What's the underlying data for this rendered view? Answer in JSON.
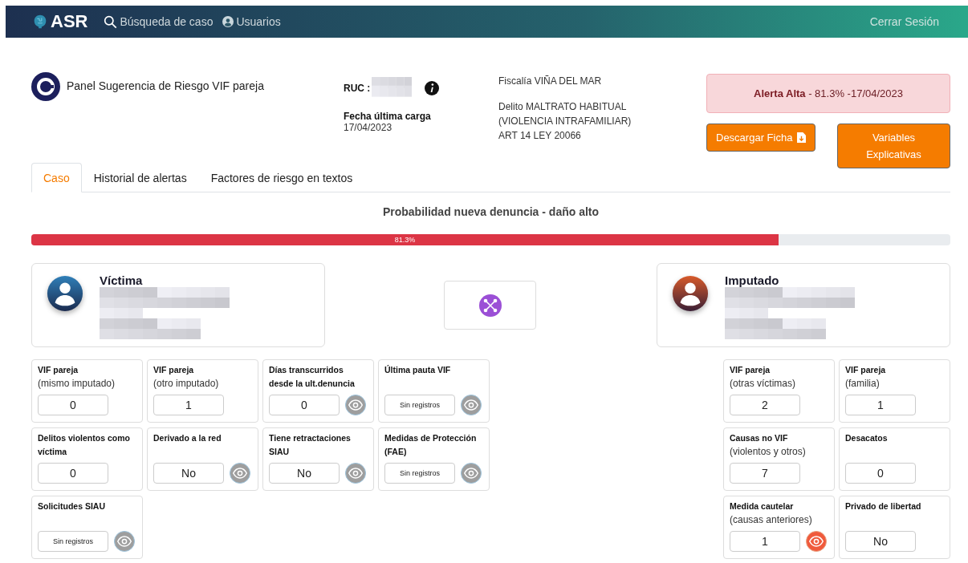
{
  "nav": {
    "brand": "ASR",
    "links": [
      {
        "label": "Búsqueda de caso"
      },
      {
        "label": "Usuarios"
      }
    ],
    "logout": "Cerrar Sesión"
  },
  "header": {
    "title": "Panel Sugerencia de Riesgo VIF pareja",
    "ruc_label": "RUC :",
    "date_label": "Fecha última carga",
    "date": "17/04/2023",
    "fiscalia": "Fiscalía VIÑA DEL MAR",
    "delito": "Delito MALTRATO HABITUAL (VIOLENCIA INTRAFAMILIAR) ART 14 LEY 20066"
  },
  "alert": {
    "label": "Alerta Alta",
    "detail": " - 81.3% -17/04/2023"
  },
  "buttons": [
    {
      "label": "Descargar Ficha"
    },
    {
      "label": "Variables Explicativas"
    }
  ],
  "tabs": [
    {
      "label": "Caso",
      "selected": true
    },
    {
      "label": "Historial de alertas",
      "selected": false
    },
    {
      "label": "Factores de riesgo en textos",
      "selected": false
    }
  ],
  "probability": {
    "title": "Probabilidad nueva denuncia - daño alto",
    "level": 0.813,
    "reading": "81.3%"
  },
  "victim": {
    "title": "Víctima"
  },
  "accused": {
    "title": "Imputado"
  },
  "victim_cards": [
    {
      "title": "VIF pareja",
      "subtitle": "(mismo imputado)",
      "value": "0",
      "empty": false
    },
    {
      "title": "VIF pareja",
      "subtitle": "(otro imputado)",
      "value": "1",
      "empty": false
    },
    {
      "title": "Días transcurridos desde la ult.denuncia",
      "value": "0",
      "empty": false,
      "eye": {
        "highlighted": false
      }
    },
    {
      "title": "Última pauta VIF",
      "value": "Sin registros",
      "empty": true,
      "eye": {
        "highlighted": false
      }
    },
    {
      "title": "Delitos violentos como víctima",
      "value": "0",
      "empty": false
    },
    {
      "title": "Derivado a la red",
      "value": "No",
      "empty": false,
      "eye": {
        "highlighted": false
      }
    },
    {
      "title": "Tiene retractaciones SIAU",
      "value": "No",
      "empty": false,
      "eye": {
        "highlighted": false
      }
    },
    {
      "title": "Medidas de Protección (FAE)",
      "value": "Sin registros",
      "empty": true,
      "eye": {
        "highlighted": false
      }
    },
    {
      "title": "Solicitudes SIAU",
      "value": "Sin registros",
      "empty": true,
      "eye": {
        "highlighted": false
      }
    }
  ],
  "accused_cards": [
    {
      "title": "VIF pareja",
      "subtitle": "(otras víctimas)",
      "value": "2",
      "empty": false
    },
    {
      "title": "VIF pareja",
      "subtitle": "(familia)",
      "value": "1",
      "empty": false
    },
    {
      "title": "Causas no VIF",
      "subtitle": "(violentos y otros)",
      "value": "7",
      "empty": false
    },
    {
      "title": "Desacatos",
      "value": "0",
      "empty": false
    },
    {
      "title": "Medida cautelar",
      "subtitle": "(causas anteriores)",
      "value": "1",
      "empty": false,
      "eye": {
        "highlighted": true
      }
    },
    {
      "title": "Privado de libertad",
      "value": "No",
      "empty": false
    }
  ]
}
